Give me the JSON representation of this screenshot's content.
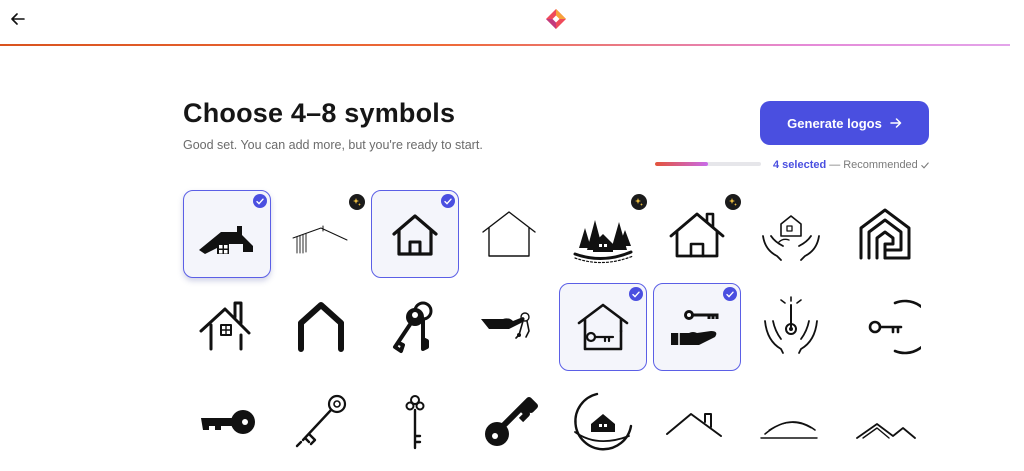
{
  "header": {
    "back_icon": "arrow-left-icon",
    "brand_icon": "brand-diamond-logo",
    "progress_colors": [
      "#d9531e",
      "#e3a4ea"
    ]
  },
  "page": {
    "title": "Choose 4–8 symbols",
    "subtitle": "Good set. You can add more, but you're ready to start."
  },
  "generate": {
    "label": "Generate logos",
    "icon": "arrow-right-icon",
    "color": "#4a4fe0"
  },
  "selection": {
    "progress_fraction": 0.5,
    "count_label": "4 selected",
    "separator": "—",
    "recommended_label": "Recommended",
    "recommended_icon": "check-small-icon"
  },
  "symbols": [
    {
      "name": "roof-house-windows",
      "selected": true,
      "premium": false
    },
    {
      "name": "thin-line-roof",
      "selected": false,
      "premium": true
    },
    {
      "name": "house-outline-bold",
      "selected": true,
      "premium": false
    },
    {
      "name": "house-outline-thin",
      "selected": false,
      "premium": false
    },
    {
      "name": "house-in-pine-forest",
      "selected": false,
      "premium": true
    },
    {
      "name": "house-with-chimney-door",
      "selected": false,
      "premium": true
    },
    {
      "name": "hands-holding-house",
      "selected": false,
      "premium": false
    },
    {
      "name": "nested-house-outline",
      "selected": false,
      "premium": false
    },
    {
      "name": "roof-chimney-window",
      "selected": false,
      "premium": false
    },
    {
      "name": "bold-roof-frame",
      "selected": false,
      "premium": false
    },
    {
      "name": "key-pair",
      "selected": false,
      "premium": false
    },
    {
      "name": "hand-holding-keys",
      "selected": false,
      "premium": false
    },
    {
      "name": "house-with-key",
      "selected": true,
      "premium": false
    },
    {
      "name": "hand-holding-key",
      "selected": true,
      "premium": false
    },
    {
      "name": "hands-with-thermometer",
      "selected": false,
      "premium": false
    },
    {
      "name": "key-in-circle",
      "selected": false,
      "premium": false
    },
    {
      "name": "solid-key",
      "selected": false,
      "premium": false
    },
    {
      "name": "vintage-key-diagonal",
      "selected": false,
      "premium": false
    },
    {
      "name": "vintage-key-vertical",
      "selected": false,
      "premium": false
    },
    {
      "name": "bold-key-diagonal",
      "selected": false,
      "premium": false
    },
    {
      "name": "house-in-circle-swoosh",
      "selected": false,
      "premium": false
    },
    {
      "name": "roof-line-chimney",
      "selected": false,
      "premium": false
    },
    {
      "name": "hill-lines",
      "selected": false,
      "premium": false
    },
    {
      "name": "double-roof-lines",
      "selected": false,
      "premium": false
    }
  ]
}
